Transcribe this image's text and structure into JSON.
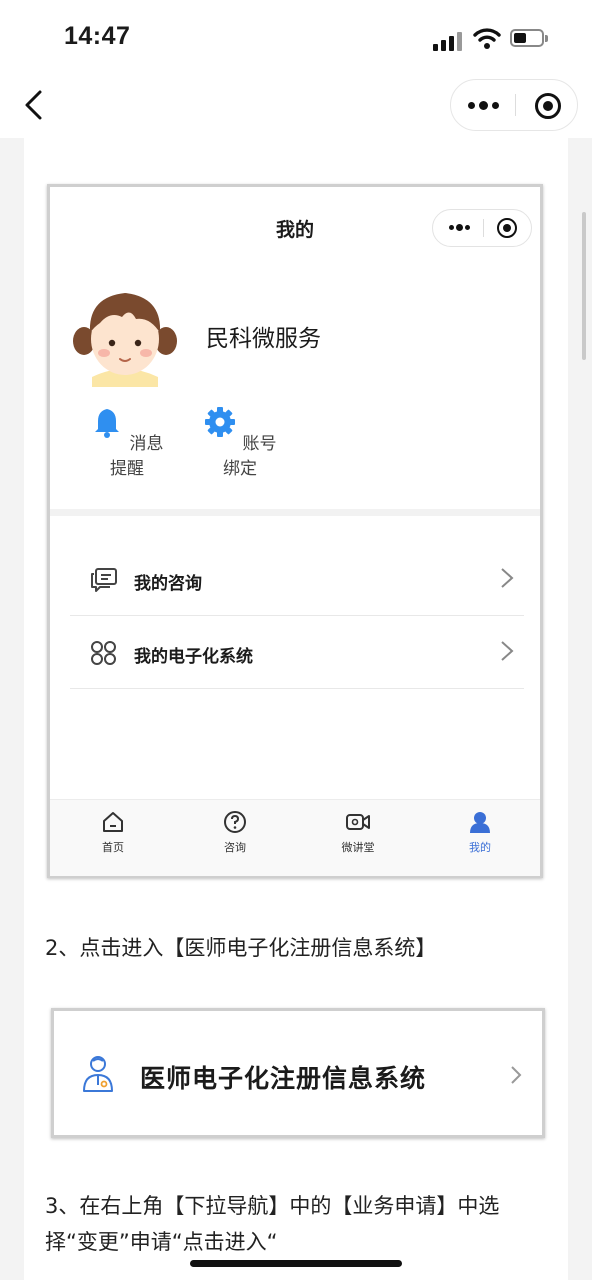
{
  "status_bar": {
    "time": "14:47"
  },
  "nav": {
    "back_icon": "back-chevron-icon",
    "capsule_more": "more-dots-icon",
    "capsule_close": "miniprogram-target-icon"
  },
  "shot1": {
    "title": "我的",
    "profile_name": "民科微服务",
    "quick_actions": [
      {
        "label": "消息提醒",
        "icon": "bell-icon",
        "color": "#2f8ff0"
      },
      {
        "label": "账号绑定",
        "icon": "gear-icon",
        "color": "#2f8ff0"
      }
    ],
    "menu": [
      {
        "label": "我的咨询",
        "icon": "chat-icon"
      },
      {
        "label": "我的电子化系统",
        "icon": "apps-icon"
      }
    ],
    "tabs": [
      {
        "label": "首页",
        "icon": "home-icon"
      },
      {
        "label": "咨询",
        "icon": "question-icon"
      },
      {
        "label": "微讲堂",
        "icon": "video-icon"
      },
      {
        "label": "我的",
        "icon": "user-icon"
      }
    ],
    "active_color": "#3b6fd6"
  },
  "step2": "2、点击进入【医师电子化注册信息系统】",
  "shot2": {
    "label": "医师电子化注册信息系统",
    "icon": "doctor-icon"
  },
  "step3": "3、在右上角【下拉导航】中的【业务申请】中选择“变更”申请“点击进入“"
}
